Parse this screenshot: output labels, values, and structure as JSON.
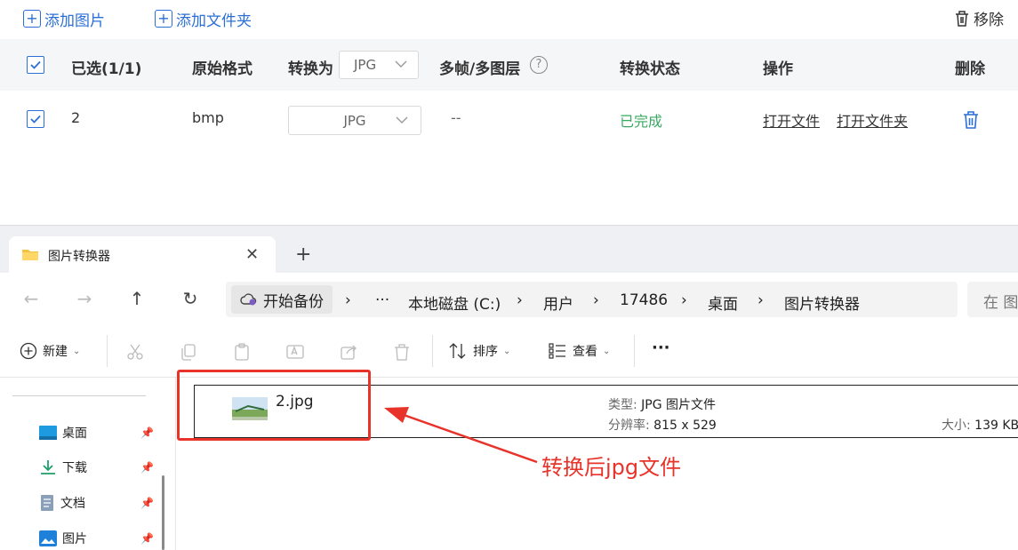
{
  "app": {
    "toolbar": {
      "add_image_label": "添加图片",
      "add_folder_label": "添加文件夹",
      "remove_label": "移除"
    },
    "table": {
      "headers": {
        "selected": "已选(1/1)",
        "original_format": "原始格式",
        "convert_to": "转换为",
        "convert_to_value": "JPG",
        "multi_frame": "多帧/多图层",
        "status": "转换状态",
        "actions": "操作",
        "delete": "删除"
      },
      "rows": [
        {
          "name": "2",
          "format": "bmp",
          "target": "JPG",
          "multi_frame": "--",
          "status": "已完成",
          "open_file": "打开文件",
          "open_folder": "打开文件夹"
        }
      ]
    },
    "colors": {
      "accent": "#2b6fd6",
      "success": "#3aa862",
      "annotation": "#e8332a"
    }
  },
  "explorer": {
    "tab_title": "图片转换器",
    "new_tab": "+",
    "address": {
      "backup": "开始备份",
      "ellipsis": "···",
      "crumbs": [
        "本地磁盘 (C:)",
        "用户",
        "17486",
        "桌面",
        "图片转换器"
      ]
    },
    "search_placeholder": "在 图",
    "commands": {
      "new": "新建",
      "sort": "排序",
      "view": "查看",
      "more": "···"
    },
    "sidebar": [
      {
        "label": "桌面",
        "icon": "desktop-icon"
      },
      {
        "label": "下载",
        "icon": "download-icon"
      },
      {
        "label": "文档",
        "icon": "document-icon"
      },
      {
        "label": "图片",
        "icon": "pictures-icon"
      }
    ],
    "file": {
      "name": "2.jpg",
      "type_label": "类型:",
      "type_value": "JPG 图片文件",
      "resolution_label": "分辨率:",
      "resolution_value": "815 x 529",
      "size_label": "大小:",
      "size_value": "139 KB"
    }
  },
  "annotation": {
    "text": "转换后jpg文件"
  }
}
